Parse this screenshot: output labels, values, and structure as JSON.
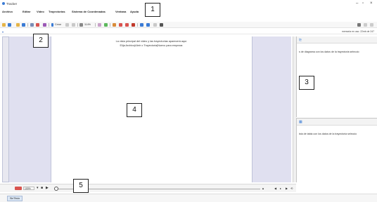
{
  "window": {
    "title": "Tracker"
  },
  "menu": [
    "Archivo",
    "Editar",
    "Video",
    "Trayectorias",
    "Sistema de Coordenadas",
    "Ventana",
    "Ayuda"
  ],
  "toolbar": {
    "crear_label": "Crear",
    "zoom_label": "114%"
  },
  "status": {
    "memory": "memoria en uso: 22mb de 247"
  },
  "video": {
    "line1": "La vista principal del video y las trayectorias aparecerá aquí.",
    "line2": "Elija Archivo|Abrir o Trayectoria|Nuevo para empezar."
  },
  "right_panel": {
    "top_msg": "s de diagrama con los datos de la trayectoria seleccio",
    "bottom_msg": "ista de tabla con los datos de la trayectoria seleccio"
  },
  "player": {
    "zoom_value": "100%"
  },
  "tabs": [
    "SinTítulo"
  ],
  "callouts": [
    "1",
    "2",
    "3",
    "4",
    "5"
  ],
  "colors": {
    "accent": "#3a7bd5",
    "record": "#d9534f",
    "side_panel": "#e0e0f0"
  }
}
